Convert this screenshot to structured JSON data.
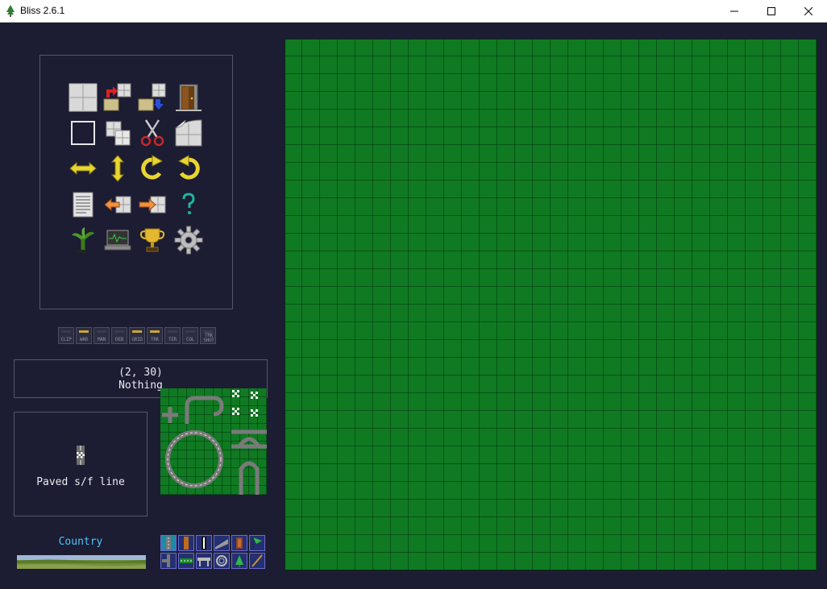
{
  "window": {
    "title": "Bliss 2.6.1",
    "minimize": "minimize",
    "maximize": "maximize",
    "close": "close"
  },
  "toolbar": {
    "tools": [
      "new-track-icon",
      "load-track-icon",
      "save-track-icon",
      "exit-door-icon",
      "select-icon",
      "copy-icon",
      "cut-icon",
      "page-curl-icon",
      "flip-horizontal-icon",
      "flip-vertical-icon",
      "rotate-clockwise-icon",
      "rotate-counterclockwise-icon",
      "track-info-icon",
      "import-icon",
      "export-icon",
      "help-icon",
      "tree-scenery-icon",
      "computer-icon",
      "trophy-icon",
      "settings-gear-icon"
    ]
  },
  "status_indicators": [
    {
      "label": "CLIP",
      "on": false
    },
    {
      "label": "WAR",
      "on": true
    },
    {
      "label": "MAN",
      "on": false
    },
    {
      "label": "DEB",
      "on": false
    },
    {
      "label": "GRID",
      "on": true
    },
    {
      "label": "TRK",
      "on": true
    },
    {
      "label": "TER",
      "on": false
    },
    {
      "label": "COL",
      "on": false
    },
    {
      "label": "TRK SHOT",
      "on": false
    }
  ],
  "info": {
    "coords": "(2, 30)",
    "object": "Nothing"
  },
  "selected_piece": {
    "name": "Paved s/f line"
  },
  "terrain": {
    "name": "Country"
  },
  "colors": {
    "background": "#1c1c33",
    "grid_fill": "#0f7a22",
    "grid_line": "#062c0d",
    "accent_text": "#4fc3f7"
  }
}
